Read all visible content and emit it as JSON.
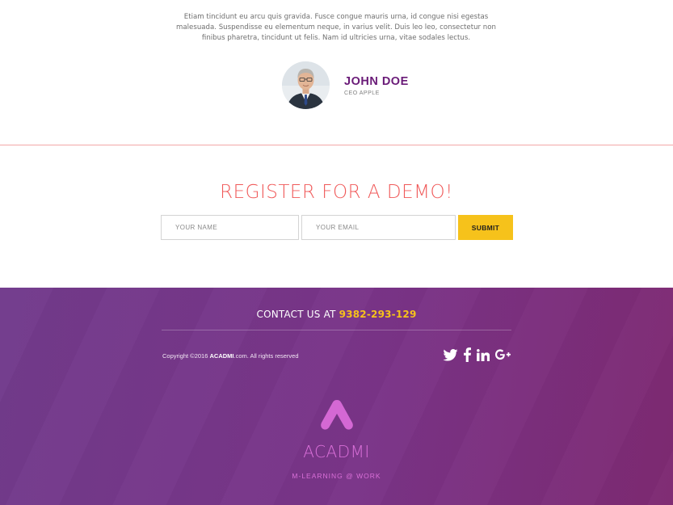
{
  "testimonial": {
    "quote": "Etiam tincidunt eu arcu quis gravida. Fusce congue mauris urna, id congue nisi egestas malesuada. Suspendisse eu elementum neque, in varius velit. Duis leo leo, consectetur non finibus pharetra, tincidunt ut felis. Nam id ultricies urna, vitae sodales lectus.",
    "author_name": "JOHN DOE",
    "author_role": "CEO APPLE"
  },
  "register": {
    "title": "REGISTER FOR A DEMO!",
    "name_placeholder": "YOUR NAME",
    "email_placeholder": "YOUR EMAIL",
    "submit_label": "SUBMIT"
  },
  "footer": {
    "contact_prefix": "CONTACT US AT",
    "phone": "9382-293-129",
    "copyright_prefix": "Copyright ©2016 ",
    "copyright_brand": "ACADMI",
    "copyright_suffix": ".com. All rights reserved",
    "social_icons": [
      "twitter-icon",
      "facebook-icon",
      "linkedin-icon",
      "google-plus-icon"
    ],
    "brand_name": "ACADMI",
    "tagline": "M-LEARNING @ WORK"
  },
  "colors": {
    "accent_red": "#f05a5a",
    "accent_yellow": "#f6c21b",
    "purple_name": "#6a1b78",
    "footer_gradient_start": "#723b8c",
    "footer_gradient_end": "#7e2a72",
    "brand_pink": "#d96fd8"
  }
}
